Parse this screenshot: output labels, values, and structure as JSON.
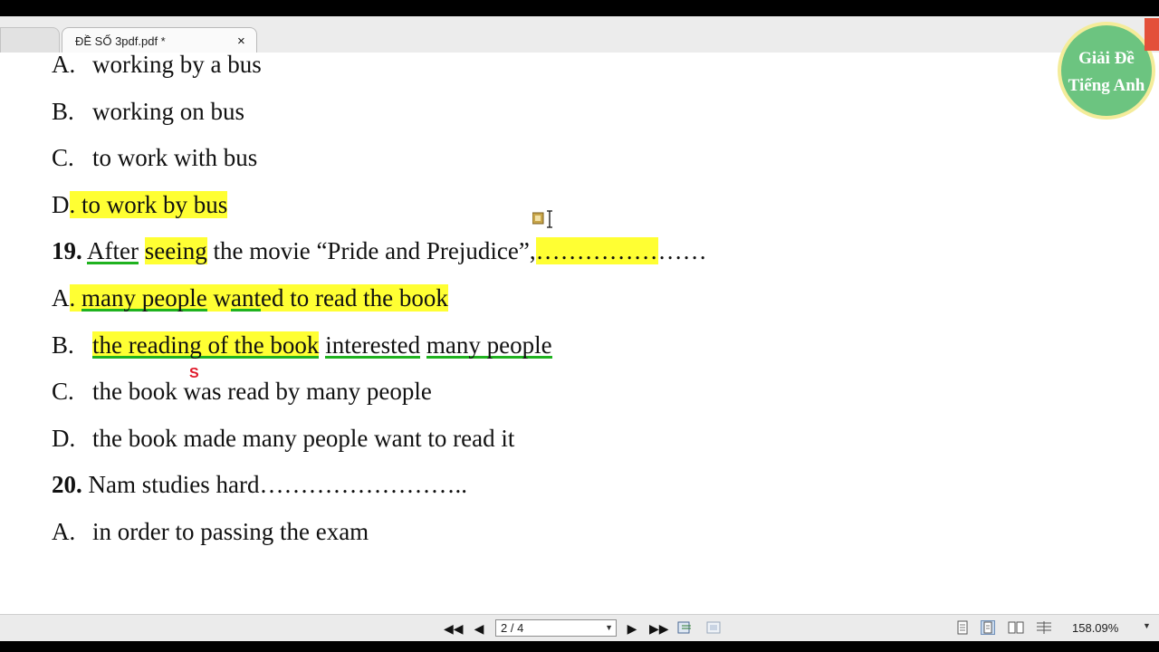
{
  "tab": {
    "title": "ĐỀ SỐ 3pdf.pdf *",
    "close": "×"
  },
  "badge": {
    "line1": "Giải Đề",
    "line2": "Tiếng Anh"
  },
  "doc": {
    "q18": {
      "a_letter": "A.",
      "a_text": "working by a bus",
      "b_letter": "B.",
      "b_text": "working on bus",
      "c_letter": "C.",
      "c_text": "to work with bus",
      "d_letter": "D",
      "d_text": ". to work by bus"
    },
    "q19": {
      "number": "19.",
      "w1": "After",
      "w2": " ",
      "w3": "seeing",
      "w4": " the movie “Pride and Prejudice”,",
      "blank_hl": "……………",
      "blank_rest": "……",
      "a_letter": "A",
      "a_p1": ". ",
      "a_p2": "many people",
      "a_p3": " w",
      "a_p4": "ant",
      "a_p5": "ed to read the book",
      "b_letter": "B.",
      "b_p1": "the reading of the book",
      "b_p2": " ",
      "b_p3": "interested",
      "b_p4": " ",
      "b_p5": "many people",
      "c_letter": "C.",
      "c_text": "the book was read by many people",
      "d_letter": "D.",
      "d_text": "the book made many people want to read it"
    },
    "q20": {
      "number": "20.",
      "text": " Nam studies hard……………………..",
      "a_letter": "A.",
      "a_text": "in order to passing the exam"
    },
    "pen_mark": "S"
  },
  "statusbar": {
    "first_page": "◀◀",
    "prev_page": "◀",
    "page_value": "2 / 4",
    "page_dropdown": "▼",
    "next_page": "▶",
    "last_page": "▶▶",
    "zoom": "158.09%",
    "zoom_dropdown": "▼"
  },
  "colors": {
    "highlight": "#ffff33",
    "underline": "#1fb21f",
    "badge": "#6cc480",
    "badge_ring": "#f4ec9a"
  }
}
